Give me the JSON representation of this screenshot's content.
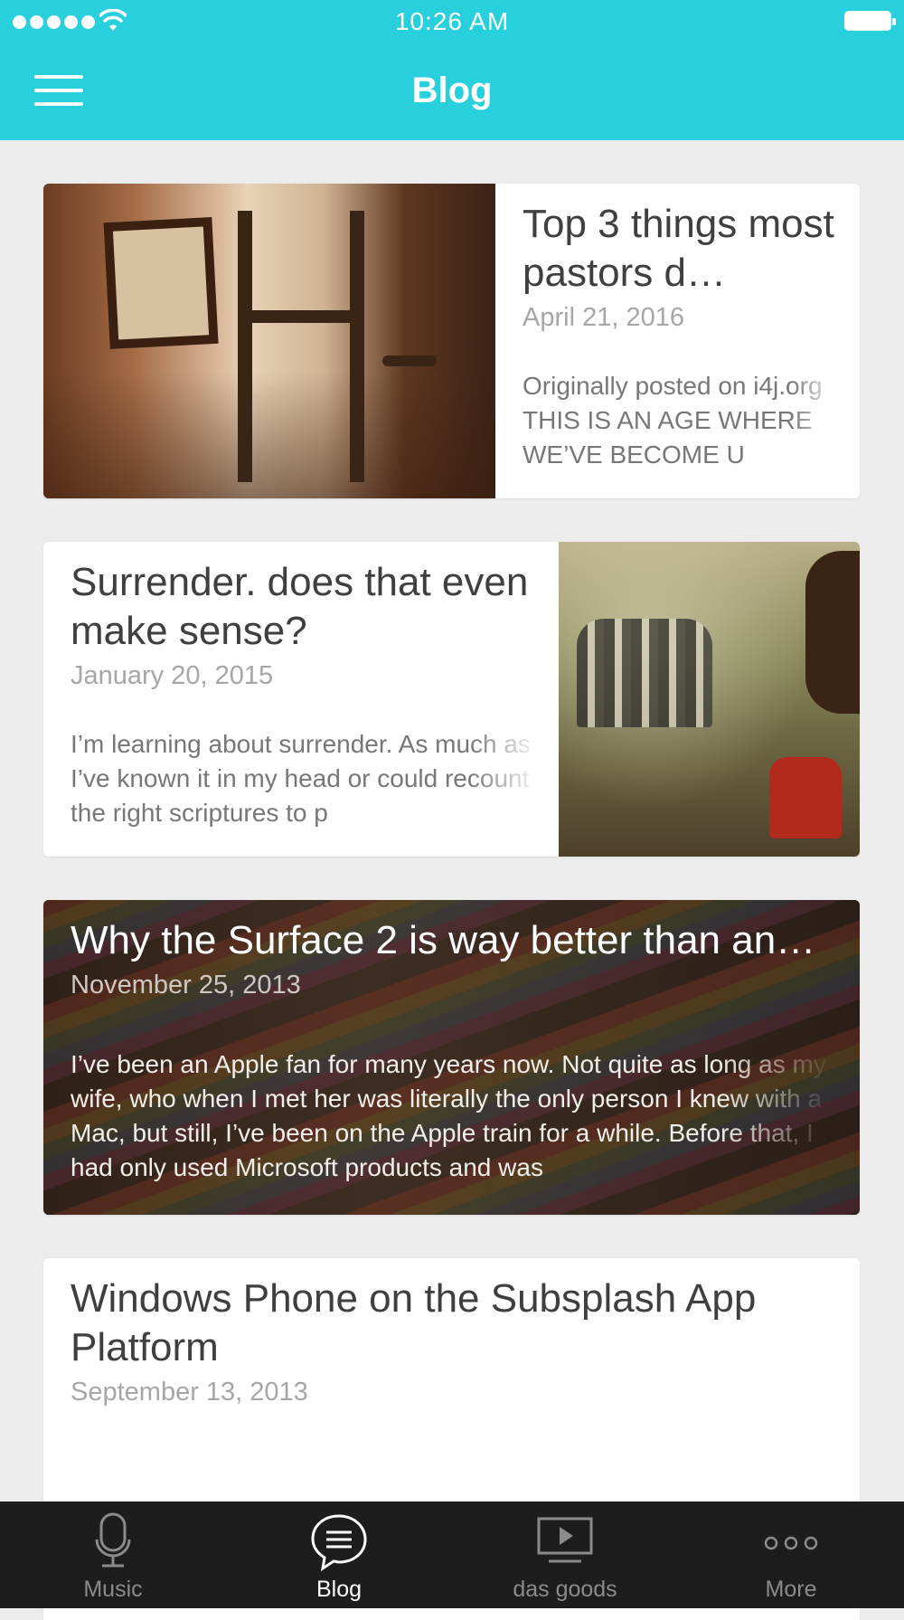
{
  "status_bar": {
    "time": "10:26 AM"
  },
  "header": {
    "title": "Blog"
  },
  "posts": [
    {
      "title": "Top 3 things most pastors d…",
      "date": "April 21, 2016",
      "excerpt": "Originally posted on i4j.org THIS IS AN AGE WHERE WE’VE BECOME U"
    },
    {
      "title": "Surrender. does that even make sense?",
      "date": "January 20, 2015",
      "excerpt": "I’m learning about surrender. As much as I’ve known it in my head or could recount the right scriptures to p"
    },
    {
      "title": "Why the Surface 2 is way better than an…",
      "date": "November 25, 2013",
      "excerpt": "I’ve been an Apple fan for many years now. Not quite as long as my wife, who when I met her was literally the only person I knew with a Mac, but still, I’ve been on the Apple train for a while. Before that, I had only used Microsoft products and was"
    },
    {
      "title": "Windows Phone on the Subsplash App Platform",
      "date": "September 13, 2013",
      "excerpt": ""
    }
  ],
  "tabs": [
    {
      "label": "Music",
      "icon": "microphone-icon",
      "active": false
    },
    {
      "label": "Blog",
      "icon": "chat-bubble-icon",
      "active": true
    },
    {
      "label": "das goods",
      "icon": "video-play-icon",
      "active": false
    },
    {
      "label": "More",
      "icon": "more-dots-icon",
      "active": false
    }
  ],
  "colors": {
    "header": "#27d0dc",
    "tabbar": "#1d1d1d",
    "background": "#ececec"
  }
}
